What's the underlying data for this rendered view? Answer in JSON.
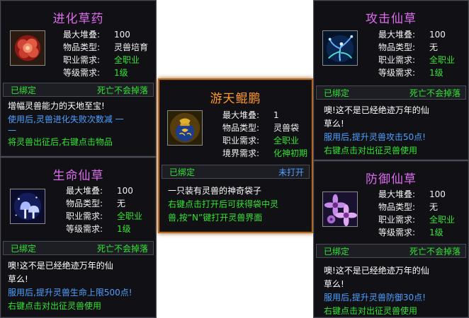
{
  "labels": {
    "stack": "最大堆叠:",
    "type": "物品类型:",
    "job": "职业需求:",
    "level": "等级需求:",
    "realm": "境界需求:"
  },
  "cards": [
    {
      "id": "jinhua",
      "title": "进化草药",
      "title_color": "#e06cf0",
      "icon": "red-flower-icon",
      "stack": "100",
      "type": "灵兽培育",
      "job": "全职业",
      "level": "1级",
      "bound": "已绑定",
      "drop": "死亡不会掉落",
      "desc": [
        "增幅灵兽能力的天地至宝!"
      ],
      "blue": [
        "使用后,灵兽进化失败次数减 一",
        "一"
      ],
      "green": [
        "将灵兽出征后,右键点击物品"
      ]
    },
    {
      "id": "shengming",
      "title": "生命仙草",
      "title_color": "#e06cf0",
      "icon": "glowing-mushroom-icon",
      "stack": "100",
      "type": "无",
      "job": "全职业",
      "level": "1级",
      "bound": "已绑定",
      "drop": "死亡不会掉落",
      "desc": [
        "噢!这不是已经绝迹万年的仙",
        "草么!"
      ],
      "blue": [
        "服用后,提升灵兽生命上限500点!"
      ],
      "green": [
        "右键点击对出征灵兽使用"
      ]
    },
    {
      "id": "youtian",
      "title": "游天鲲鹏",
      "title_color": "#ff9a2a",
      "icon": "blue-pouch-icon",
      "stack": "1",
      "type": "灵兽袋",
      "job": "全职业",
      "realm": "化神初期",
      "bound": "已绑定",
      "drop": "未打开",
      "desc": [
        "一只装有灵兽的神奇袋子"
      ],
      "green": [
        "右键点击打开后可获得袋中灵",
        "兽,按“N”键打开灵兽界面"
      ]
    },
    {
      "id": "gongji",
      "title": "攻击仙草",
      "title_color": "#e06cf0",
      "icon": "blue-herb-icon",
      "stack": "100",
      "type": "无",
      "job": "全职业",
      "level": "1级",
      "bound": "已绑定",
      "drop": "死亡不会掉落",
      "desc": [
        "噢!这不是已经绝迹万年的仙",
        "草么!"
      ],
      "blue": [
        "服用后,提升灵兽攻击50点!"
      ],
      "green": [
        "右键点击对出征灵兽使用"
      ]
    },
    {
      "id": "fangyu",
      "title": "防御仙草",
      "title_color": "#e06cf0",
      "icon": "purple-flower-icon",
      "stack": "100",
      "type": "无",
      "job": "全职业",
      "level": "1级",
      "bound": "已绑定",
      "drop": "死亡不会掉落",
      "desc": [
        "噢!这不是已经绝迹万年的仙",
        "草么!"
      ],
      "blue": [
        "服用后,提升灵兽防御30点!"
      ],
      "green": [
        "右键点击对出征灵兽使用"
      ]
    }
  ]
}
